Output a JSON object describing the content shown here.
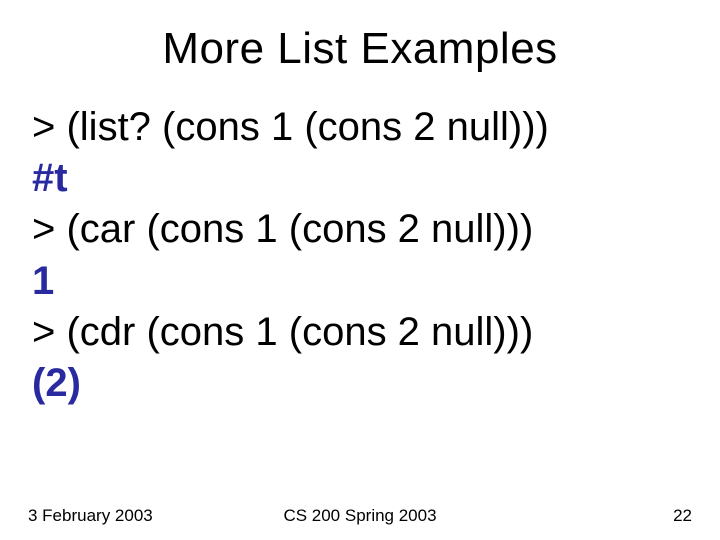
{
  "title": "More List Examples",
  "lines": {
    "l1": "> (list? (cons 1 (cons 2 null)))",
    "r1": "#t",
    "l2": "> (car (cons 1 (cons 2 null)))",
    "r2": "1",
    "l3": "> (cdr (cons 1 (cons 2 null)))",
    "r3": "(2)"
  },
  "footer": {
    "date": "3 February 2003",
    "course": "CS 200 Spring 2003",
    "page": "22"
  }
}
